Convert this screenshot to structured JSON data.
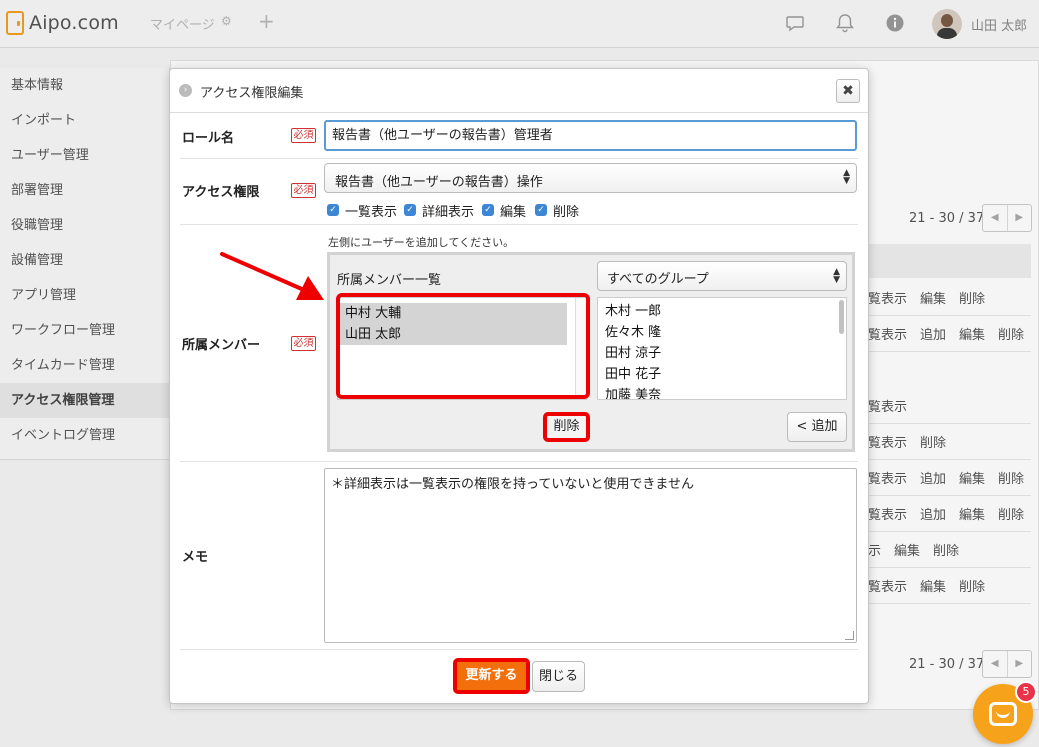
{
  "app": {
    "logo_text": "Aipo.com",
    "nav_mypage": "マイページ",
    "user_name": "山田 太郎",
    "icons": [
      "chat-bubble-icon",
      "bell-icon",
      "info-icon",
      "gear-icon",
      "plus-icon"
    ]
  },
  "sidebar": {
    "items": [
      {
        "label": "基本情報"
      },
      {
        "label": "インポート"
      },
      {
        "label": "ユーザー管理"
      },
      {
        "label": "部署管理"
      },
      {
        "label": "役職管理"
      },
      {
        "label": "設備管理"
      },
      {
        "label": "アプリ管理"
      },
      {
        "label": "ワークフロー管理"
      },
      {
        "label": "タイムカード管理"
      },
      {
        "label": "アクセス権限管理"
      },
      {
        "label": "イベントログ管理"
      }
    ],
    "active_index": 9
  },
  "background_table": {
    "pager_text": "21 - 30 / 37",
    "rows": [
      {
        "actions": "覧表示　編集　削除"
      },
      {
        "actions": "覧表示　追加　編集　削除"
      },
      {
        "actions": "覧表示"
      },
      {
        "actions": "覧表示　削除"
      },
      {
        "actions": "覧表示　追加　編集　削除"
      },
      {
        "actions": "覧表示　追加　編集　削除"
      },
      {
        "actions": "示　編集　削除"
      },
      {
        "actions": "覧表示　編集　削除"
      }
    ]
  },
  "dialog": {
    "title": "アクセス権限編集",
    "close_symbol": "✖",
    "required_label": "必須",
    "role_name": {
      "label": "ロール名",
      "value": "報告書（他ユーザーの報告書）管理者"
    },
    "access": {
      "label": "アクセス権限",
      "selected": "報告書（他ユーザーの報告書）操作",
      "checkboxes": [
        {
          "label": "一覧表示",
          "checked": true
        },
        {
          "label": "詳細表示",
          "checked": true
        },
        {
          "label": "編集",
          "checked": true
        },
        {
          "label": "削除",
          "checked": true
        }
      ]
    },
    "members": {
      "label": "所属メンバー",
      "hint": "左側にユーザーを追加してください。",
      "list_label": "所属メンバー一覧",
      "selected_members": [
        "中村 大輔",
        "山田 太郎"
      ],
      "group_select": "すべてのグループ",
      "user_options": [
        "木村 一郎",
        "佐々木 隆",
        "田村 涼子",
        "田中 花子",
        "加藤 美奈"
      ],
      "delete_label": "削除",
      "add_label": "< 追加"
    },
    "memo": {
      "label": "メモ",
      "value": "＊詳細表示は一覧表示の権限を持っていないと使用できません"
    },
    "save_label": "更新する",
    "close_label": "閉じる"
  },
  "chat_widget": {
    "badge_count": "5"
  },
  "colors": {
    "accent_orange": "#f26f0c",
    "highlight_red": "#e00000",
    "checkbox_blue": "#3d86d6",
    "focus_blue": "#5b9bd5"
  }
}
